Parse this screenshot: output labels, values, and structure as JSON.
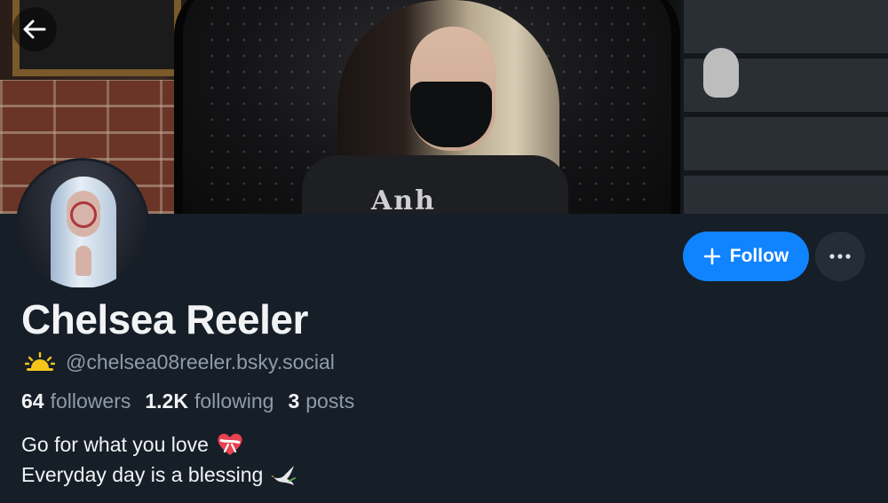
{
  "profile": {
    "display_name": "Chelsea Reeler",
    "handle": "@chelsea08reeler.bsky.social",
    "handle_icon": "sunrise-icon",
    "stats": {
      "followers_count": "64",
      "followers_label": "followers",
      "following_count": "1.2K",
      "following_label": "following",
      "posts_count": "3",
      "posts_label": "posts"
    },
    "bio": {
      "line1": "Go for what you love",
      "line1_icon": "heart-with-ribbon-icon",
      "line2": "Everyday day is a blessing",
      "line2_icon": "dove-icon"
    },
    "banner_print": "Anh"
  },
  "actions": {
    "follow_label": "Follow",
    "more_icon": "ellipsis-icon",
    "back_icon": "back-arrow-icon"
  },
  "colors": {
    "background": "#161e27",
    "accent": "#1083fe",
    "text_primary": "#f1f3f5",
    "text_secondary": "#8f9bab"
  }
}
